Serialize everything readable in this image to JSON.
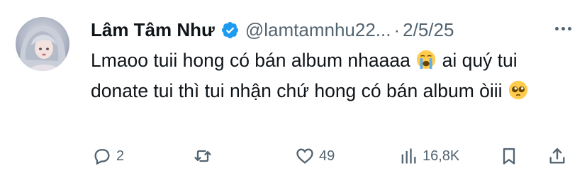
{
  "tweet": {
    "author_name": "Lâm Tâm Như",
    "handle": "@lamtamnhu22...",
    "separator": "·",
    "date": "2/5/25",
    "text_part1": "Lmaoo tuii hong có bán album nhaaaa",
    "text_part2": " ai quý tui donate tui thì tui nhận chứ hong có bán album òiii",
    "emoji_1": "loudly-crying-face",
    "emoji_2": "pleading-face"
  },
  "actions": {
    "replies": "2",
    "retweets": "",
    "likes": "49",
    "views": "16,8K"
  },
  "colors": {
    "verified": "#1d9bf0",
    "muted": "#536471",
    "text": "#0f1419"
  }
}
